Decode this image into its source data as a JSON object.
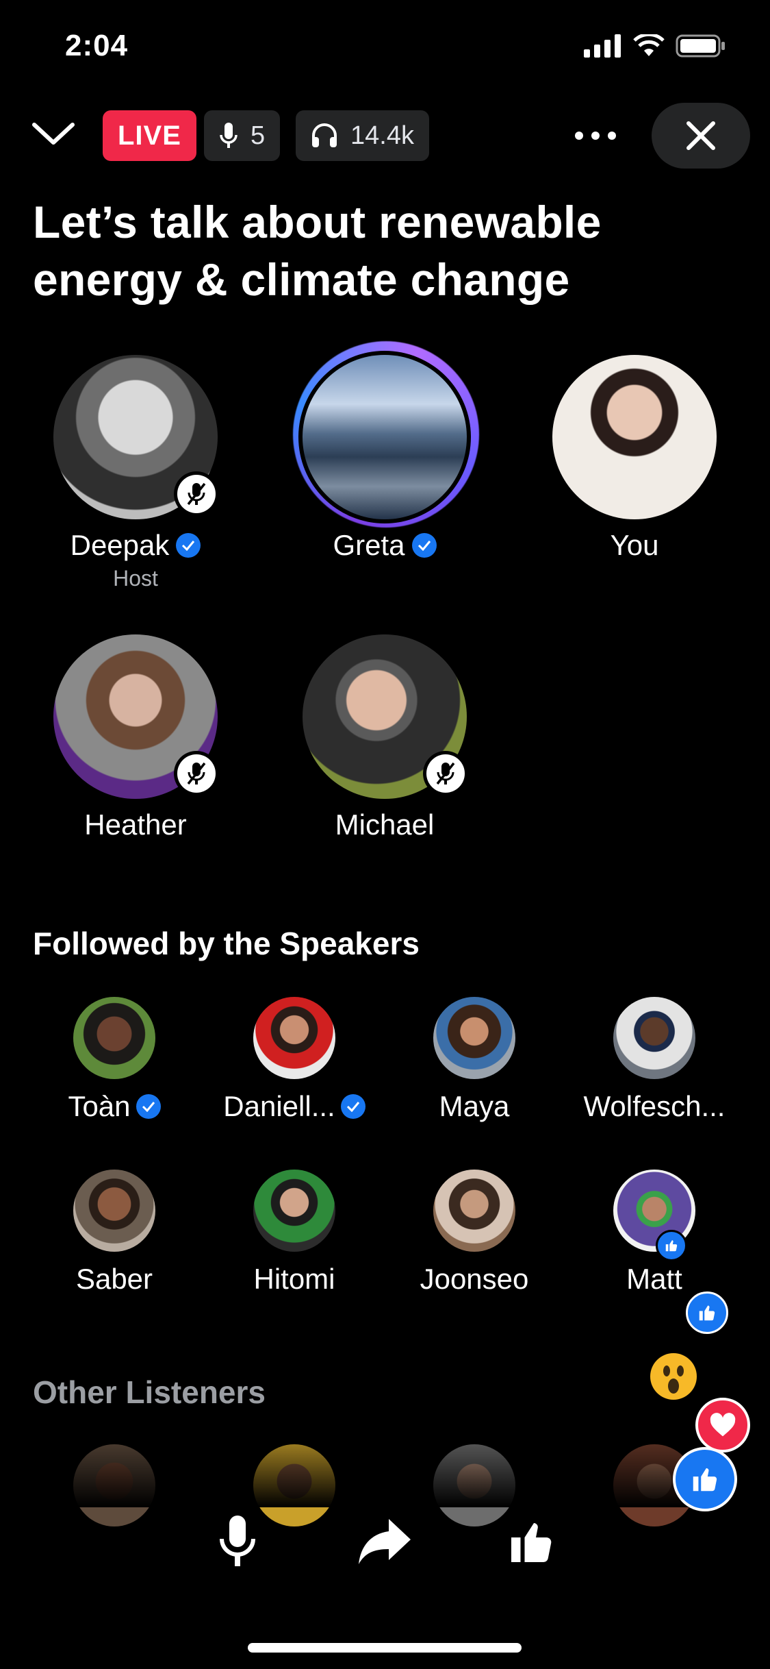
{
  "status_bar": {
    "time": "2:04"
  },
  "header": {
    "live_label": "LIVE",
    "speakers_count": "5",
    "listeners_count": "14.4k"
  },
  "room": {
    "title": "Let’s talk about renewable energy & climate change"
  },
  "speakers": [
    {
      "name": "Deepak",
      "role": "Host",
      "verified": true,
      "muted": true
    },
    {
      "name": "Greta",
      "verified": true,
      "muted": false,
      "speaking": true
    },
    {
      "name": "You",
      "verified": false,
      "muted": false
    },
    {
      "name": "Heather",
      "verified": false,
      "muted": true
    },
    {
      "name": "Michael",
      "verified": false,
      "muted": true
    }
  ],
  "followed_section": {
    "title": "Followed by the Speakers",
    "people": [
      {
        "name": "Toàn",
        "verified": true
      },
      {
        "name": "Daniell...",
        "verified": true
      },
      {
        "name": "Maya"
      },
      {
        "name": "Wolfesch..."
      },
      {
        "name": "Saber"
      },
      {
        "name": "Hitomi"
      },
      {
        "name": "Joonseo"
      },
      {
        "name": "Matt"
      }
    ]
  },
  "other_section": {
    "title": "Other Listeners"
  },
  "colors": {
    "live": "#f02849",
    "verified": "#1877f2",
    "chip": "#242526",
    "heart": "#f02849"
  }
}
